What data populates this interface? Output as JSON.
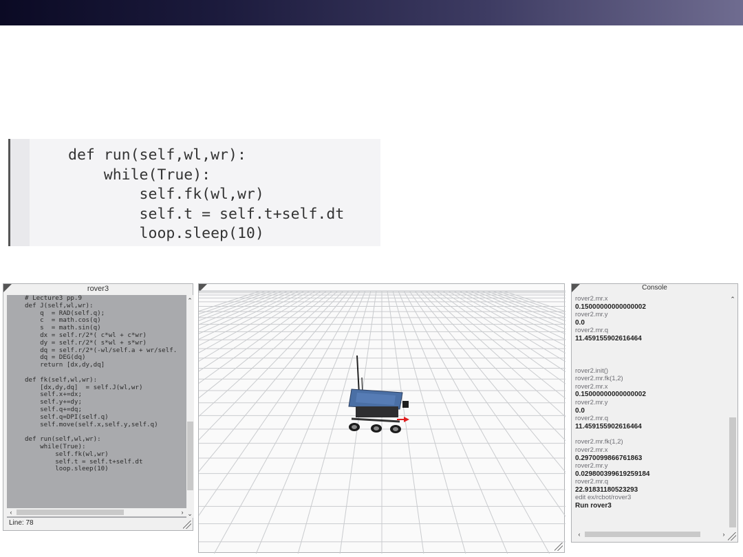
{
  "snippet": {
    "lines": [
      "def run(self,wl,wr):",
      "    while(True):",
      "        self.fk(wl,wr)",
      "        self.t = self.t+self.dt",
      "        loop.sleep(10)"
    ]
  },
  "editor": {
    "title": "rover3",
    "status": "Line: 78",
    "code_lines": [
      "# Lecture3 pp.9",
      "def J(self,wl,wr):",
      "    q  = RAD(self.q);",
      "    c  = math.cos(q)",
      "    s  = math.sin(q)",
      "    dx = self.r/2*( c*wl + c*wr)",
      "    dy = self.r/2*( s*wl + s*wr)",
      "    dq = self.r/2*(-wl/self.a + wr/self.",
      "    dq = DEG(dq)",
      "    return [dx,dy,dq]",
      "",
      "def fk(self,wl,wr):",
      "    [dx,dy,dq]  = self.J(wl,wr)",
      "    self.x+=dx;",
      "    self.y+=dy;",
      "    self.q+=dq;",
      "    self.q=DPI(self.q)",
      "    self.move(self.x,self.y,self.q)",
      "",
      "def run(self,wl,wr):",
      "    while(True):",
      "        self.fk(wl,wr)",
      "        self.t = self.t+self.dt",
      "        loop.sleep(10)"
    ]
  },
  "console": {
    "title": "Console",
    "block1": [
      {
        "text": "rover2.mr.x",
        "kind": "cmd"
      },
      {
        "text": "0.15000000000000002",
        "kind": "out"
      },
      {
        "text": "rover2.mr.y",
        "kind": "cmd"
      },
      {
        "text": "0.0",
        "kind": "out"
      },
      {
        "text": "rover2.mr.q",
        "kind": "cmd"
      },
      {
        "text": "11.459155902616464",
        "kind": "out"
      }
    ],
    "block2": [
      {
        "text": "rover2.init()",
        "kind": "cmd"
      },
      {
        "text": "rover2.mr.fk(1,2)",
        "kind": "cmd"
      },
      {
        "text": "rover2.mr.x",
        "kind": "cmd"
      },
      {
        "text": "0.15000000000000002",
        "kind": "out"
      },
      {
        "text": "rover2.mr.y",
        "kind": "cmd"
      },
      {
        "text": "0.0",
        "kind": "out"
      },
      {
        "text": "rover2.mr.q",
        "kind": "cmd"
      },
      {
        "text": "11.459155902616464",
        "kind": "out"
      }
    ],
    "block3": [
      {
        "text": "rover2.mr.fk(1,2)",
        "kind": "cmd"
      },
      {
        "text": "rover2.mr.x",
        "kind": "cmd"
      },
      {
        "text": "0.2970099866761863",
        "kind": "out"
      },
      {
        "text": "rover2.mr.y",
        "kind": "cmd"
      },
      {
        "text": "0.029800399619259184",
        "kind": "out"
      },
      {
        "text": "rover2.mr.q",
        "kind": "cmd"
      },
      {
        "text": "22.91831180523293",
        "kind": "out"
      },
      {
        "text": "edit ex/rcbot/rover3",
        "kind": "cmd"
      },
      {
        "text": "Run rover3",
        "kind": "out"
      }
    ]
  },
  "icons": {
    "scroll_up": "chevron-up-icon",
    "scroll_down": "chevron-down-icon",
    "scroll_left": "chevron-left-icon",
    "scroll_right": "chevron-right-icon"
  },
  "colors": {
    "header_dark": "#0b0a24",
    "header_light": "#6f6c90",
    "editor_bg": "#a9aaad",
    "rover_panel": "#4a6fa5",
    "rover_arrow": "#e02020"
  }
}
